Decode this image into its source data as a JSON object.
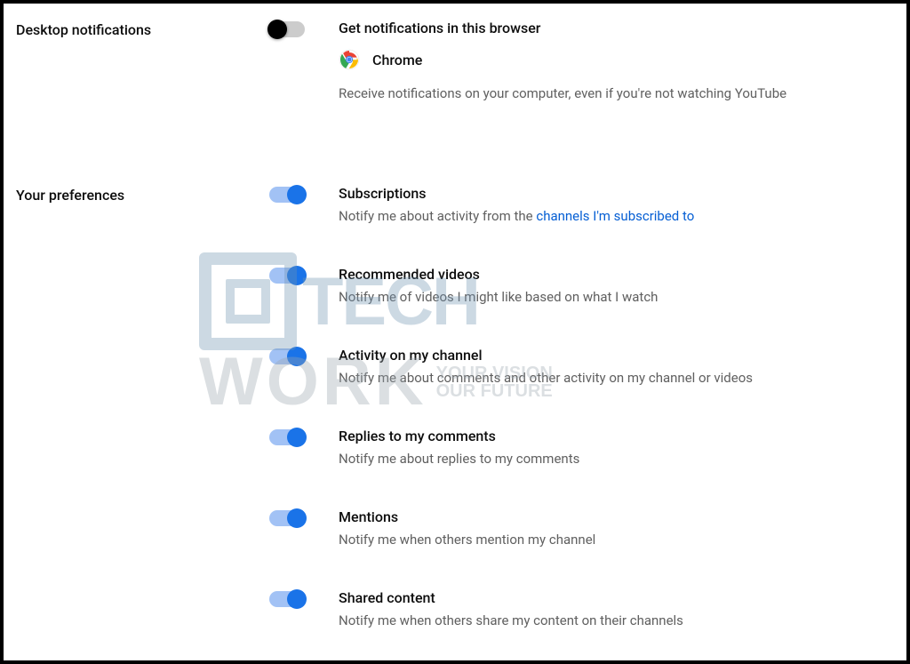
{
  "sections": {
    "desktop": {
      "label": "Desktop notifications",
      "title": "Get notifications in this browser",
      "browser": "Chrome",
      "desc": "Receive notifications on your computer, even if you're not watching YouTube"
    },
    "prefs": {
      "label": "Your preferences",
      "items": [
        {
          "title": "Subscriptions",
          "desc_prefix": "Notify me about activity from the ",
          "link": "channels I'm subscribed to"
        },
        {
          "title": "Recommended videos",
          "desc": "Notify me of videos I might like based on what I watch"
        },
        {
          "title": "Activity on my channel",
          "desc": "Notify me about comments and other activity on my channel or videos"
        },
        {
          "title": "Replies to my comments",
          "desc": "Notify me about replies to my comments"
        },
        {
          "title": "Mentions",
          "desc": "Notify me when others mention my channel"
        },
        {
          "title": "Shared content",
          "desc": "Notify me when others share my content on their channels"
        }
      ]
    }
  },
  "watermark": {
    "top": "TECH",
    "bottom": "WORK",
    "tag1": "YOUR VISION",
    "tag2": "OUR FUTURE"
  }
}
